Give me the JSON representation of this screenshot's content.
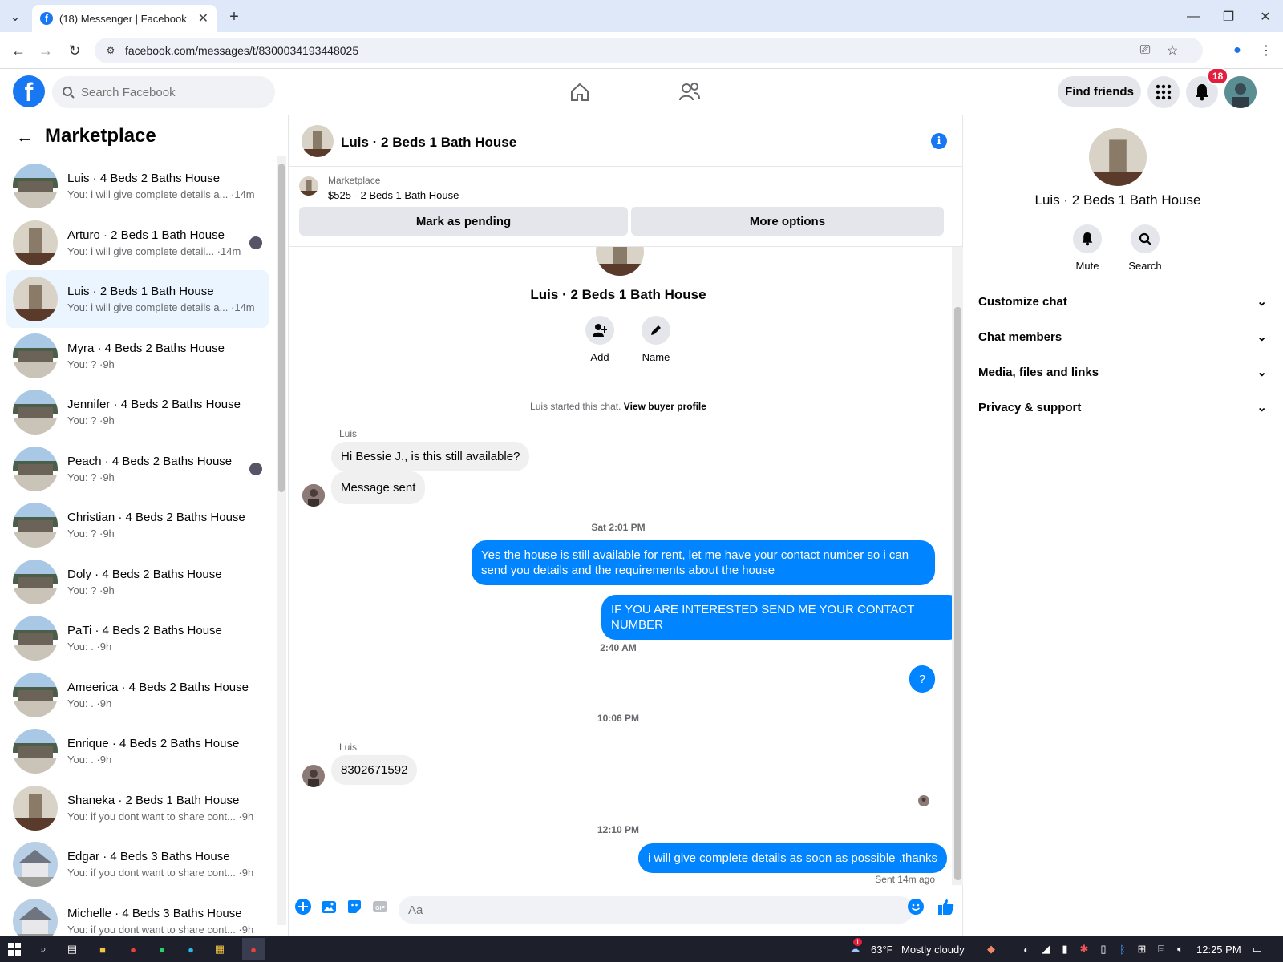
{
  "browser": {
    "tab_title": "(18) Messenger | Facebook",
    "url": "facebook.com/messages/t/8300034193448025"
  },
  "fb_header": {
    "search_placeholder": "Search Facebook",
    "find_friends": "Find friends",
    "notification_count": "18"
  },
  "sidebar": {
    "title": "Marketplace",
    "conversations": [
      {
        "name": "Luis · 4 Beds 2 Baths House",
        "snippet": "You: i will give complete details a... ·14m",
        "thumb": "house-exterior",
        "active": false
      },
      {
        "name": "Arturo · 2 Beds 1 Bath House",
        "snippet": "You: i will give complete detail... ·14m",
        "thumb": "room-interior",
        "active": false
      },
      {
        "name": "Luis · 2 Beds 1 Bath House",
        "snippet": "You: i will give complete details a... ·14m",
        "thumb": "room-interior",
        "active": true
      },
      {
        "name": "Myra · 4 Beds 2 Baths House",
        "snippet": "You: ? ·9h",
        "thumb": "house-exterior",
        "active": false
      },
      {
        "name": "Jennifer · 4 Beds 2 Baths House",
        "snippet": "You: ? ·9h",
        "thumb": "house-exterior",
        "active": false
      },
      {
        "name": "Peach · 4 Beds 2 Baths House",
        "snippet": "You: ? ·9h",
        "thumb": "house-exterior",
        "active": false
      },
      {
        "name": "Christian · 4 Beds 2 Baths House",
        "snippet": "You: ? ·9h",
        "thumb": "house-exterior",
        "active": false
      },
      {
        "name": "Doly · 4 Beds 2 Baths House",
        "snippet": "You: ? ·9h",
        "thumb": "house-exterior",
        "active": false
      },
      {
        "name": "PaTi · 4 Beds 2 Baths House",
        "snippet": "You: . ·9h",
        "thumb": "house-exterior",
        "active": false
      },
      {
        "name": "Ameerica · 4 Beds 2 Baths House",
        "snippet": "You: . ·9h",
        "thumb": "house-exterior",
        "active": false
      },
      {
        "name": "Enrique · 4 Beds 2 Baths House",
        "snippet": "You: . ·9h",
        "thumb": "house-exterior",
        "active": false
      },
      {
        "name": "Shaneka · 2 Beds 1 Bath House",
        "snippet": "You: if you dont want to share cont... ·9h",
        "thumb": "room-interior",
        "active": false
      },
      {
        "name": "Edgar · 4 Beds 3 Baths House",
        "snippet": "You: if you dont want to share cont... ·9h",
        "thumb": "house-white",
        "active": false
      },
      {
        "name": "Michelle · 4 Beds 3 Baths House",
        "snippet": "You: if you dont want to share cont... ·9h",
        "thumb": "house-white",
        "active": false
      }
    ]
  },
  "chat": {
    "title": "Luis · 2 Beds 1 Bath House",
    "marketplace_label": "Marketplace",
    "listing": "$525 - 2 Beds 1 Bath House",
    "mark_pending": "Mark as pending",
    "more_options": "More options",
    "intro_name": "Luis · 2 Beds 1 Bath House",
    "add_label": "Add",
    "name_label": "Name",
    "started_text": "Luis started this chat.",
    "view_profile": "View buyer profile",
    "sender_1": "Luis",
    "msg_in_1": "Hi Bessie J., is this still available?",
    "msg_in_2": "Message sent",
    "ts_1": "Sat 2:01 PM",
    "msg_out_1": "Yes the house is still available for rent, let me have your contact number so i can send you details and the requirements about the house",
    "msg_out_2": "IF YOU ARE INTERESTED SEND ME YOUR CONTACT NUMBER",
    "ts_2": "2:40 AM",
    "msg_out_3": "?",
    "ts_3": "10:06 PM",
    "sender_2": "Luis",
    "msg_in_3": "8302671592",
    "ts_4": "12:10 PM",
    "msg_out_4": "i will give complete details as soon as possible .thanks",
    "sent_status": "Sent 14m ago",
    "composer_placeholder": "Aa"
  },
  "right_panel": {
    "name": "Luis · 2 Beds 1 Bath House",
    "mute": "Mute",
    "search": "Search",
    "sections": [
      "Customize chat",
      "Chat members",
      "Media, files and links",
      "Privacy & support"
    ]
  },
  "taskbar": {
    "weather": "63°F",
    "weather_desc": "Mostly cloudy",
    "time": "12:25 PM",
    "weather_alert": "1"
  },
  "colors": {
    "accent": "#0084ff",
    "fb_blue": "#1877f2",
    "badge_red": "#e41e3f"
  }
}
